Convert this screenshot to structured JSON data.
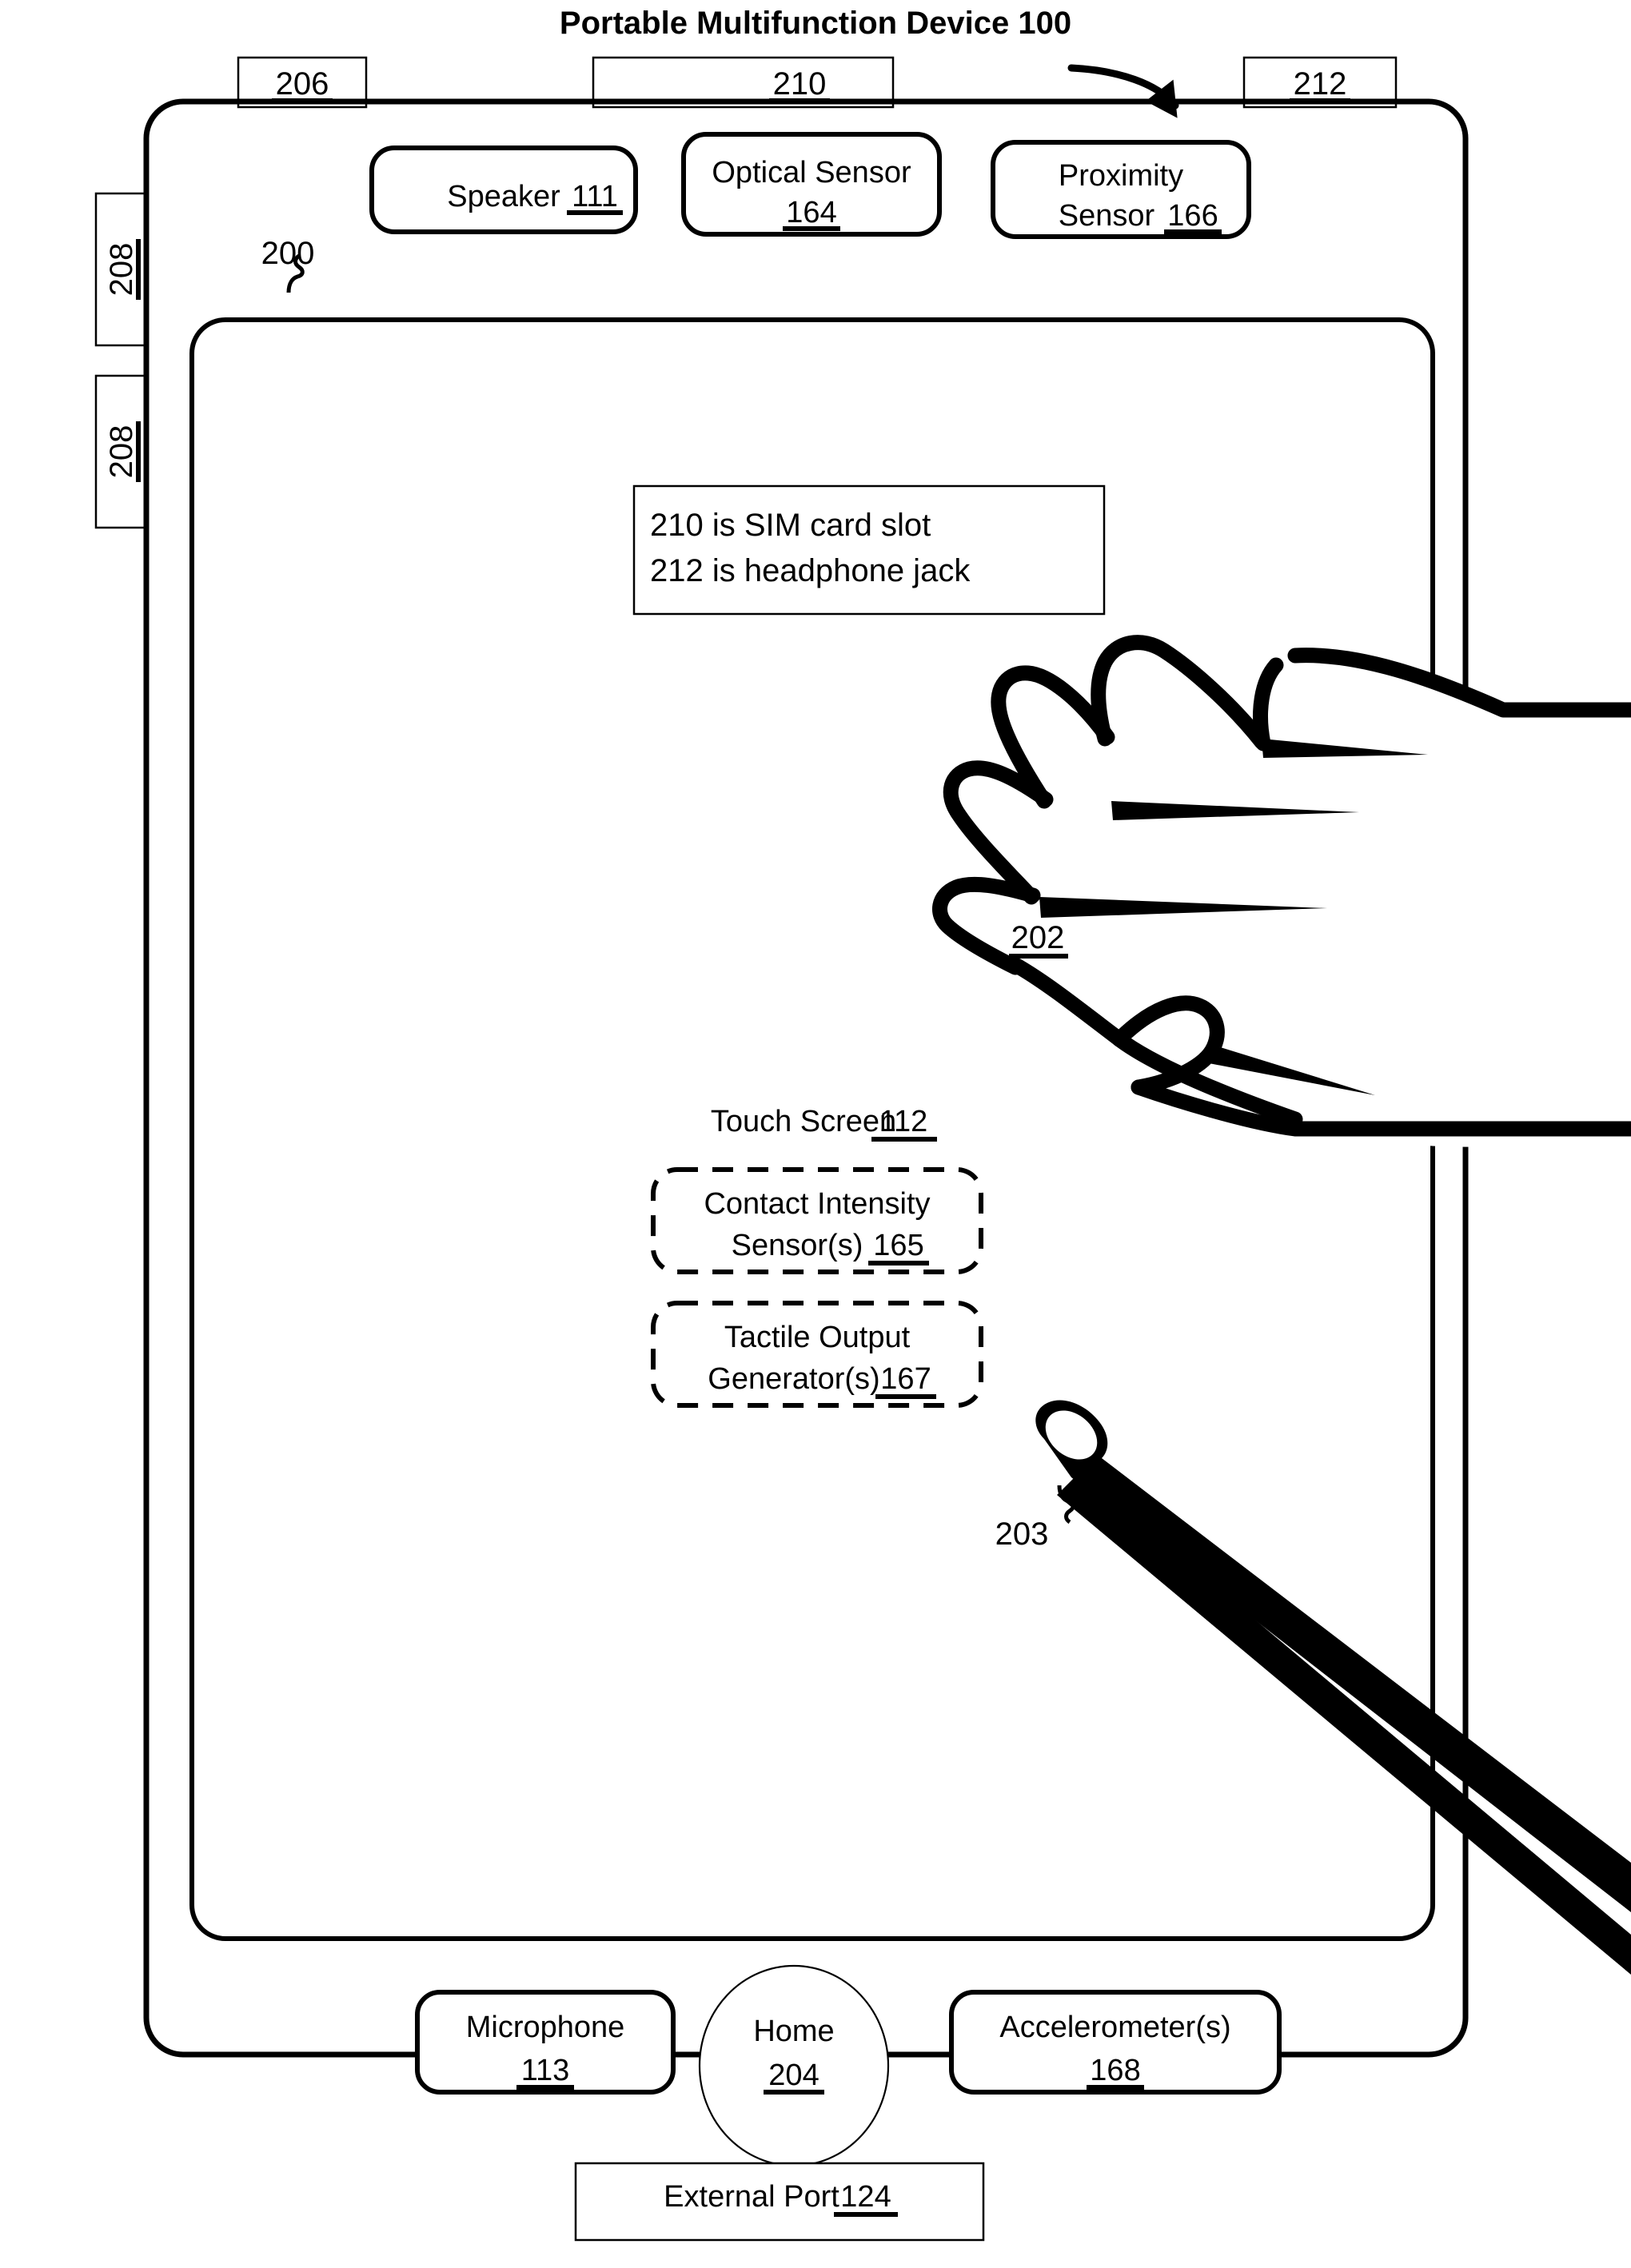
{
  "figure": {
    "title": "Portable Multifunction Device 100",
    "device_ref": "200",
    "note_box": {
      "line1": "210 is SIM card slot",
      "line2": "212 is headphone jack"
    },
    "edge_refs": {
      "top_left": "206",
      "top_center": "210",
      "top_right": "212",
      "side_upper": "208",
      "side_lower": "208"
    },
    "top_components": [
      {
        "name": "speaker",
        "label": "Speaker",
        "ref": "111"
      },
      {
        "name": "optical-sensor",
        "label": "Optical Sensor",
        "ref": "164"
      },
      {
        "name": "proximity-sensor",
        "label": "Proximity",
        "label2": "Sensor",
        "ref": "166"
      }
    ],
    "screen": {
      "label": "Touch Screen",
      "ref": "112",
      "optional_modules": [
        {
          "name": "contact-intensity-sensor",
          "line1": "Contact Intensity",
          "line2": "Sensor(s)",
          "ref": "165"
        },
        {
          "name": "tactile-output-generator",
          "line1": "Tactile Output",
          "line2": "Generator(s)",
          "ref": "167"
        }
      ]
    },
    "finger_ref": "202",
    "stylus_ref": "203",
    "bottom_components": [
      {
        "name": "microphone",
        "label": "Microphone",
        "ref": "113"
      },
      {
        "name": "home-button",
        "label": "Home",
        "ref": "204"
      },
      {
        "name": "accelerometer",
        "label": "Accelerometer(s)",
        "ref": "168"
      }
    ],
    "external_port": {
      "label": "External Port",
      "ref": "124"
    },
    "colors": {
      "ink": "#000000",
      "paper": "#ffffff"
    }
  }
}
